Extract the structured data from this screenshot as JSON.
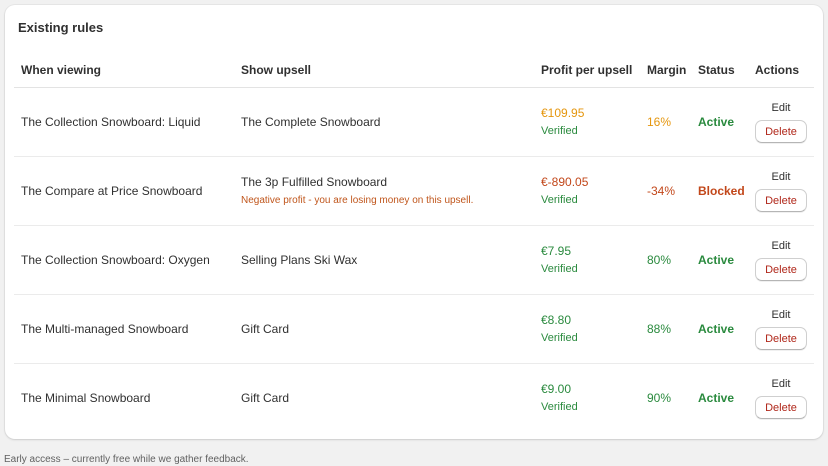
{
  "card": {
    "title": "Existing rules"
  },
  "table": {
    "headers": {
      "when_viewing": "When viewing",
      "show_upsell": "Show upsell",
      "profit": "Profit per upsell",
      "margin": "Margin",
      "status": "Status",
      "actions": "Actions"
    },
    "rows": [
      {
        "when_viewing": "The Collection Snowboard: Liquid",
        "show_upsell": "The Complete Snowboard",
        "warning": "",
        "profit": "€109.95",
        "verified": "Verified",
        "margin": "16%",
        "status": "Active",
        "edit": "Edit",
        "delete": "Delete"
      },
      {
        "when_viewing": "The Compare at Price Snowboard",
        "show_upsell": "The 3p Fulfilled Snowboard",
        "warning": "Negative profit - you are losing money on this upsell.",
        "profit": "€-890.05",
        "verified": "Verified",
        "margin": "-34%",
        "status": "Blocked",
        "edit": "Edit",
        "delete": "Delete"
      },
      {
        "when_viewing": "The Collection Snowboard: Oxygen",
        "show_upsell": "Selling Plans Ski Wax",
        "warning": "",
        "profit": "€7.95",
        "verified": "Verified",
        "margin": "80%",
        "status": "Active",
        "edit": "Edit",
        "delete": "Delete"
      },
      {
        "when_viewing": "The Multi-managed Snowboard",
        "show_upsell": "Gift Card",
        "warning": "",
        "profit": "€8.80",
        "verified": "Verified",
        "margin": "88%",
        "status": "Active",
        "edit": "Edit",
        "delete": "Delete"
      },
      {
        "when_viewing": "The Minimal Snowboard",
        "show_upsell": "Gift Card",
        "warning": "",
        "profit": "€9.00",
        "verified": "Verified",
        "margin": "90%",
        "status": "Active",
        "edit": "Edit",
        "delete": "Delete"
      }
    ]
  },
  "footer": {
    "note": "Early access – currently free while we gather feedback."
  },
  "colors": {
    "active": "#2a8a3e",
    "blocked": "#c2471a",
    "low_margin": "#e5960e",
    "delete_text": "#b0271a"
  }
}
